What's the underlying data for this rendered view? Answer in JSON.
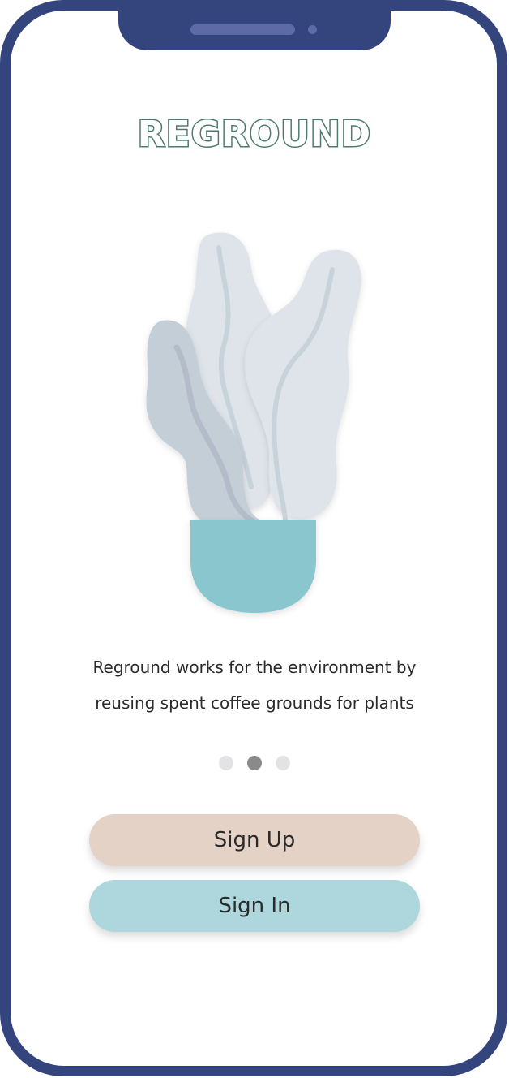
{
  "app": {
    "title": "REGROUND"
  },
  "onboarding": {
    "description_line1": "Reground works for the environment by",
    "description_line2": "reusing spent coffee grounds for plants",
    "pagination": {
      "total": 3,
      "active_index": 1
    }
  },
  "actions": {
    "signup_label": "Sign Up",
    "signin_label": "Sign In"
  },
  "colors": {
    "frame": "#34447c",
    "title_outline": "#4c7a6f",
    "signup_bg": "#e4d2c7",
    "signin_bg": "#add7dc",
    "pot": "#89c6cd",
    "leaf_light": "#dfe4ea",
    "leaf_dark": "#c4ced6"
  },
  "icons": {
    "illustration": "potted-plant-illustration"
  }
}
